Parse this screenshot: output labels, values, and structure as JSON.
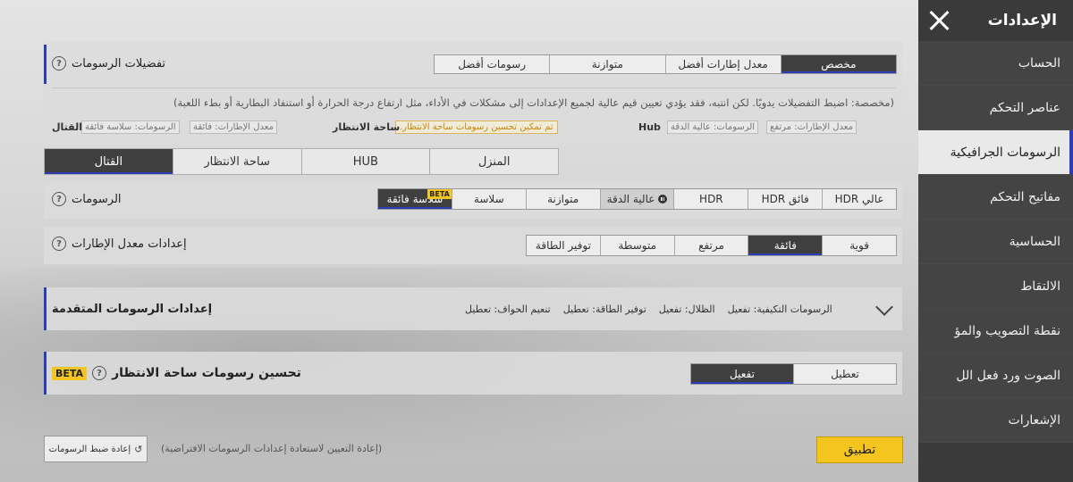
{
  "sidebar": {
    "title": "الإعدادات",
    "items": [
      {
        "label": "الحساب",
        "active": false
      },
      {
        "label": "عناصر التحكم",
        "active": false
      },
      {
        "label": "الرسومات الجرافيكية",
        "active": true
      },
      {
        "label": "مفاتيح التحكم",
        "active": false
      },
      {
        "label": "الحساسية",
        "active": false
      },
      {
        "label": "الالتقاط",
        "active": false
      },
      {
        "label": "نقطة التصويب والمؤ",
        "active": false
      },
      {
        "label": "الصوت ورد فعل الل",
        "active": false
      },
      {
        "label": "الإشعارات",
        "active": false
      }
    ]
  },
  "graphics_pref": {
    "title": "تفضيلات الرسومات",
    "options": [
      "مخصص",
      "معدل إطارات أفضل",
      "متوازنة",
      "رسومات أفضل"
    ],
    "selected": "مخصص",
    "description": "(مخصصة: اضبط التفضيلات يدويًا. لكن انتبه، فقد يؤدي تعيين قيم عالية لجميع الإعدادات إلى مشكلات في الأداء، مثل ارتفاع درجة الحرارة أو استنفاد البطارية أو بطء اللعبة)",
    "tags_right": [
      "معدل الإطارات: مرتفع",
      "الرسومات: عالية الدقة"
    ],
    "hub_label": "Hub",
    "lobby_label": "ساحة الانتظار",
    "lobby_warning": "تم تمكين تحسين رسومات ساحة الانتظار.",
    "tags_left": [
      "معدل الإطارات: فائقة",
      "الرسومات: سلاسة فائقة"
    ],
    "combat_label": "القتال"
  },
  "scene_tabs": {
    "options": [
      "المنزل",
      "HUB",
      "ساحة الانتظار",
      "القتال"
    ],
    "selected": "القتال"
  },
  "graphics": {
    "title": "الرسومات",
    "options": [
      "عالي HDR",
      "فائق HDR",
      "HDR",
      "عالية الدقة",
      "متوازنة",
      "سلاسة",
      "سلاسة فائقة"
    ],
    "selected": "سلاسة فائقة",
    "beta": "BETA"
  },
  "frame_rate": {
    "title": "إعدادات معدل الإطارات",
    "options": [
      "قوية",
      "فائقة",
      "مرتفع",
      "متوسطة",
      "توفير الطاقة"
    ],
    "selected": "فائقة"
  },
  "advanced": {
    "title": "إعدادات الرسومات المتقدمة",
    "items": [
      "الرسومات التكيفية: تفعيل",
      "الظلال: تفعيل",
      "توفير الطاقة: تعطيل",
      "تنعيم الحواف: تعطيل"
    ]
  },
  "lobby_enhance": {
    "title": "تحسين رسومات ساحة الانتظار",
    "beta": "BETA",
    "options": [
      "تعطيل",
      "تفعيل"
    ],
    "selected": "تفعيل"
  },
  "footer": {
    "reset_label": "إعادة ضبط الرسومات",
    "reset_note": "(إعادة التعيين لاستعادة إعدادات الرسومات الافتراضية)",
    "apply_label": "تطبيق"
  },
  "colors": {
    "accent": "#2d3db5",
    "apply": "#f5c51f",
    "beta": "#f4c524",
    "sidebar": "#3a3a3a"
  }
}
